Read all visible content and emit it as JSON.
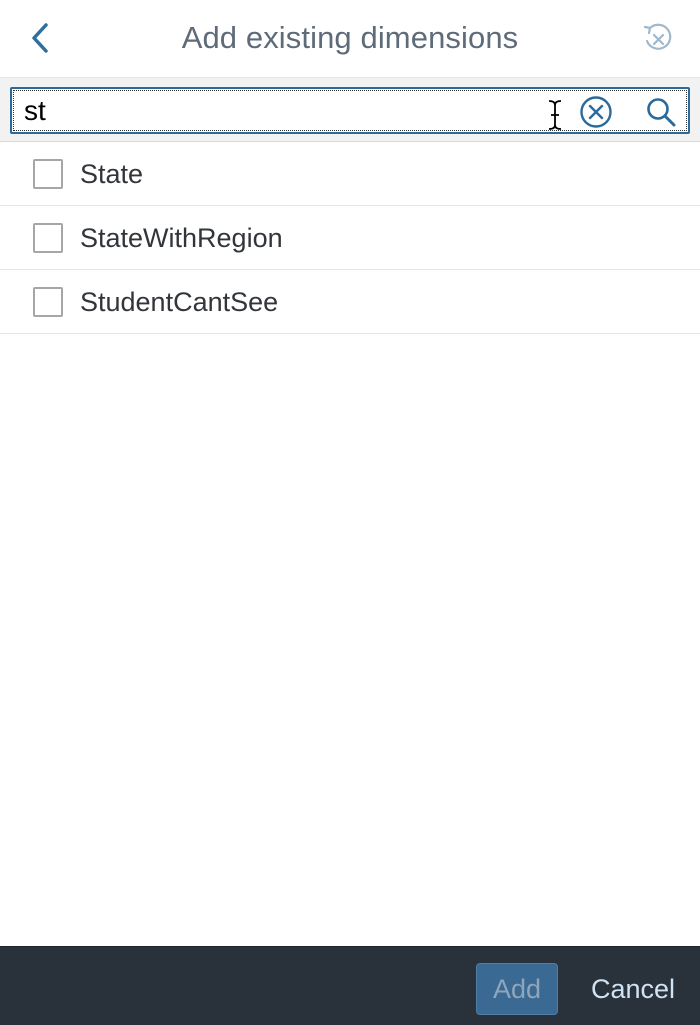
{
  "dialog": {
    "title": "Add existing dimensions",
    "back_icon": "chevron-left-icon",
    "reset_icon": "reset-icon"
  },
  "search": {
    "value": "st",
    "clear_icon": "clear-icon",
    "search_icon": "search-icon"
  },
  "list": {
    "items": [
      {
        "label": "State",
        "checked": false
      },
      {
        "label": "StateWithRegion",
        "checked": false
      },
      {
        "label": "StudentCantSee",
        "checked": false
      }
    ]
  },
  "footer": {
    "add_label": "Add",
    "cancel_label": "Cancel"
  },
  "colors": {
    "accent": "#2a6a9c",
    "footer_bg": "#29313a",
    "add_button_bg": "#3a6a93"
  }
}
